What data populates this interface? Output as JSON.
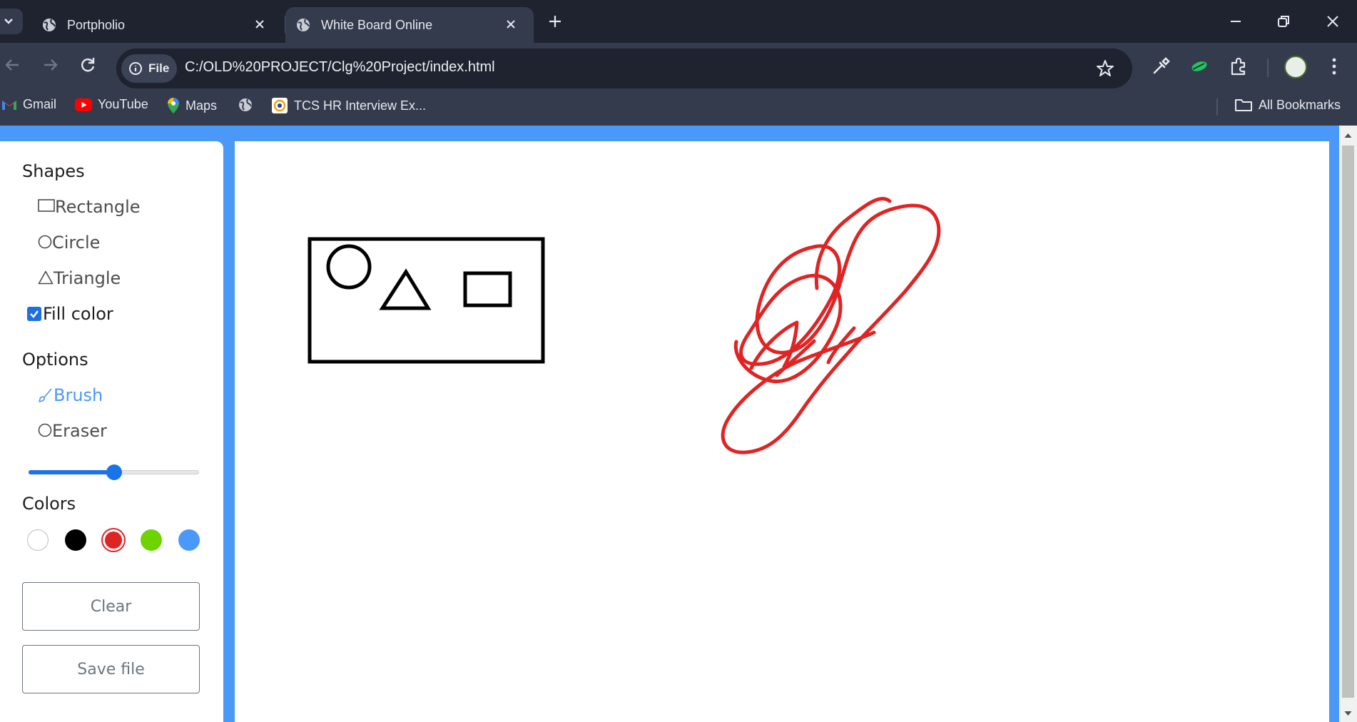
{
  "browser": {
    "tabs": [
      {
        "title": "Portpholio",
        "active": false
      },
      {
        "title": "White Board Online",
        "active": true
      }
    ],
    "site_chip": "File",
    "url": "C:/OLD%20PROJECT/Clg%20Project/index.html",
    "bookmarks": [
      "Gmail",
      "YouTube",
      "Maps",
      "TCS HR Interview Ex..."
    ],
    "all_bookmarks": "All Bookmarks"
  },
  "sidebar": {
    "shapes_title": "Shapes",
    "shapes": [
      "Rectangle",
      "Circle",
      "Triangle"
    ],
    "fill_color_label": "Fill color",
    "fill_color_checked": true,
    "options_title": "Options",
    "options": [
      {
        "label": "Brush",
        "icon": "brush-icon",
        "active": true
      },
      {
        "label": "Eraser",
        "icon": "eraser-icon",
        "active": false
      }
    ],
    "brush_size_fraction": 0.5,
    "colors_title": "Colors",
    "colors": [
      "#ffffff",
      "#000000",
      "#e02424",
      "#6dd400",
      "#4a98f7"
    ],
    "selected_color": "#e02424",
    "clear_label": "Clear",
    "save_label": "Save file"
  },
  "canvas": {
    "stroke_colors": {
      "shapes": "#000000",
      "scribble": "#e02424"
    }
  }
}
